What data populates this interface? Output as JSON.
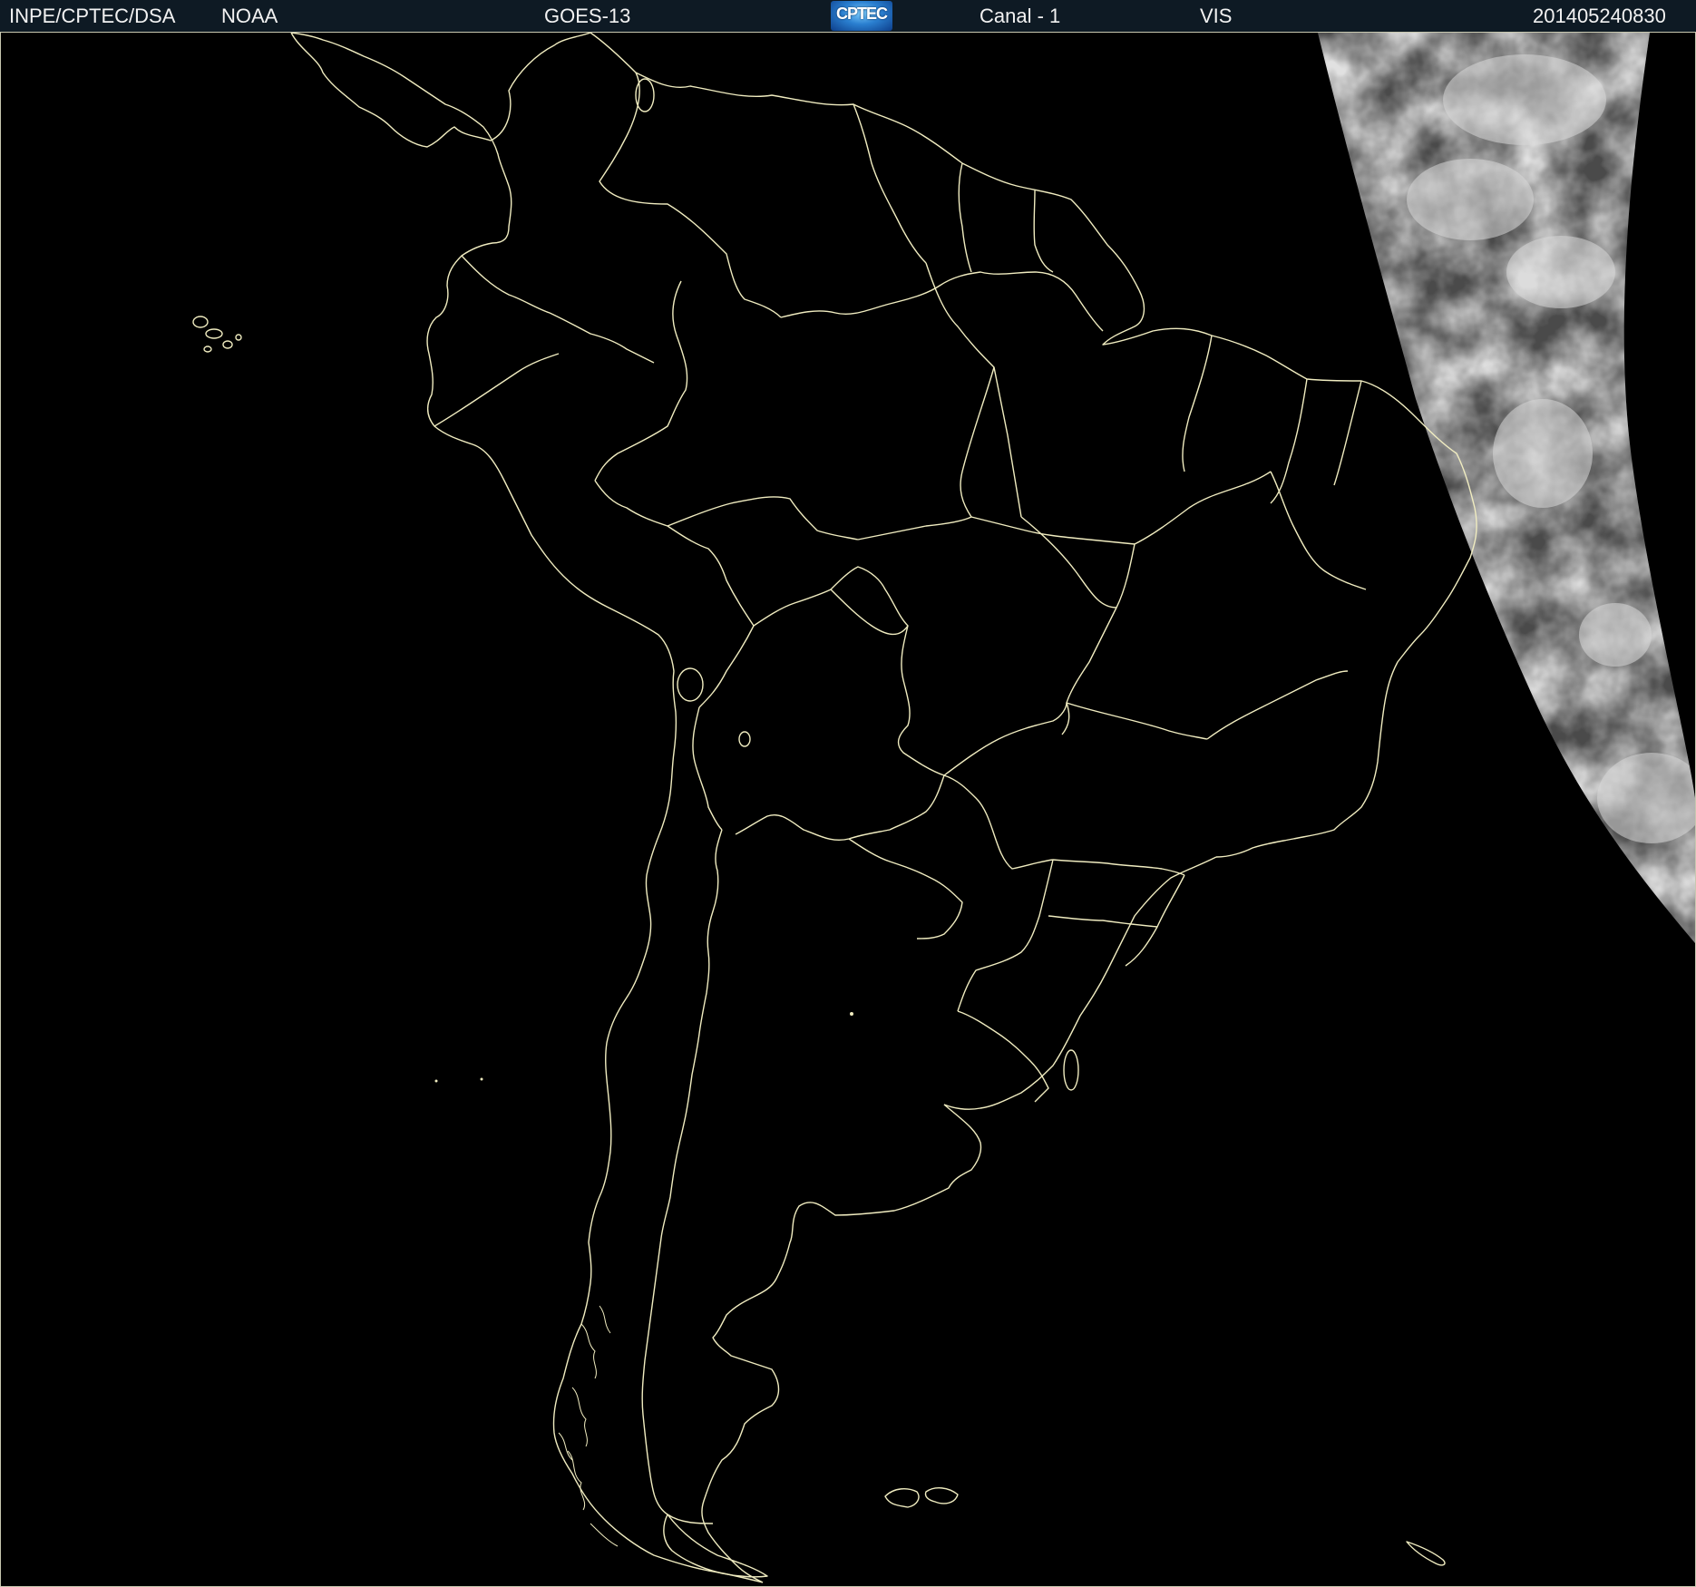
{
  "header": {
    "institution": "INPE/CPTEC/DSA",
    "agency": "NOAA",
    "satellite": "GOES-13",
    "logo_text": "CPTEC",
    "channel": "Canal - 1",
    "band": "VIS",
    "timestamp": "201405240830"
  },
  "map": {
    "region": "South America",
    "border_color": "#f0ecc0",
    "background_color": "#000000",
    "cloud_color": "#9a9a9a"
  }
}
